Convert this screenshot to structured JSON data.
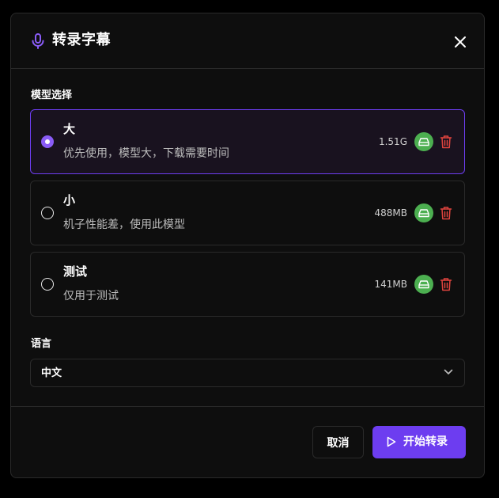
{
  "dialog": {
    "title": "转录字幕",
    "icons": {
      "title": "microphone-icon",
      "close": "close-icon"
    }
  },
  "model_section": {
    "label": "模型选择",
    "options": [
      {
        "name": "大",
        "description": "优先使用，模型大，下载需要时间",
        "size": "1.51G",
        "selected": true
      },
      {
        "name": "小",
        "description": "机子性能差，使用此模型",
        "size": "488MB",
        "selected": false
      },
      {
        "name": "测试",
        "description": "仅用于测试",
        "size": "141MB",
        "selected": false
      }
    ]
  },
  "language_section": {
    "label": "语言",
    "selected": "中文"
  },
  "footer": {
    "cancel_label": "取消",
    "start_label": "开始转录"
  },
  "colors": {
    "accent": "#6d3df0",
    "radio_selected": "#8a5cf7",
    "drive": "#4caf50",
    "delete": "#e0443e",
    "dialog_bg": "#0e0e0e",
    "border": "#2a2a2a"
  }
}
